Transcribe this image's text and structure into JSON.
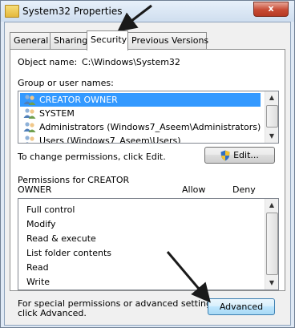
{
  "window": {
    "title": "System32 Properties",
    "close_label": "x"
  },
  "tabs": [
    {
      "label": "General"
    },
    {
      "label": "Sharing"
    },
    {
      "label": "Security",
      "active": true
    },
    {
      "label": "Previous Versions"
    }
  ],
  "object": {
    "label": "Object name:",
    "value": "C:\\Windows\\System32"
  },
  "groups": {
    "label": "Group or user names:",
    "items": [
      {
        "label": "CREATOR OWNER",
        "selected": true
      },
      {
        "label": "SYSTEM"
      },
      {
        "label": "Administrators (Windows7_Aseem\\Administrators)"
      },
      {
        "label": "Users (Windows7_Aseem\\Users)"
      }
    ]
  },
  "change": {
    "text": "To change permissions, click Edit.",
    "edit_label": "Edit..."
  },
  "permissions": {
    "header_line1": "Permissions for CREATOR",
    "header_line2": "OWNER",
    "allow_label": "Allow",
    "deny_label": "Deny",
    "items": [
      {
        "label": "Full control"
      },
      {
        "label": "Modify"
      },
      {
        "label": "Read & execute"
      },
      {
        "label": "List folder contents"
      },
      {
        "label": "Read"
      },
      {
        "label": "Write"
      }
    ]
  },
  "special": {
    "line1": "For special permissions or advanced settings,",
    "line2": "click Advanced.",
    "advanced_label": "Advanced"
  },
  "colors": {
    "selection": "#3399ff",
    "arrow": "#1a1a1a"
  }
}
